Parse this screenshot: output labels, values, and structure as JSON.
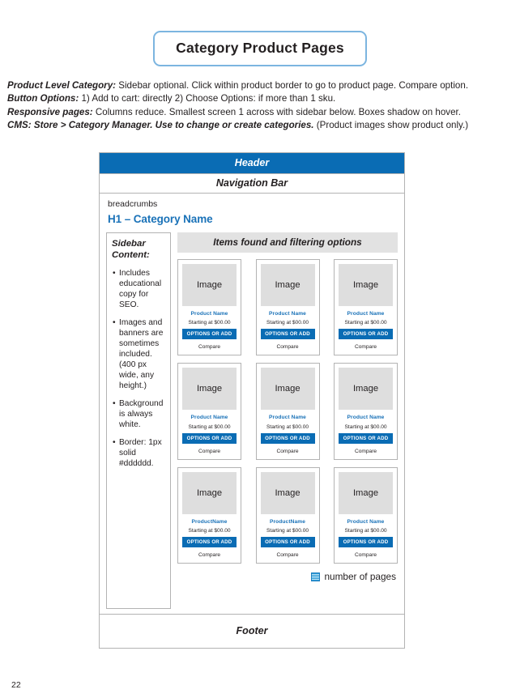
{
  "title": "Category Product Pages",
  "notes": [
    {
      "lead": "Product Level Category:",
      "rest": " Sidebar optional. Click within product border to go to product page. Compare option."
    },
    {
      "lead": "Button Options:",
      "rest": " 1) Add to cart: directly 2) Choose Options: if more than 1 sku."
    },
    {
      "lead": "Responsive pages:",
      "rest": " Columns reduce. Smallest screen 1 across with sidebar below. Boxes shadow on hover."
    },
    {
      "lead": "CMS: Store > Category Manager. Use to change or create categories.",
      "rest": " (Product images show product only.)"
    }
  ],
  "wireframe": {
    "header": "Header",
    "nav": "Navigation Bar",
    "breadcrumbs": "breadcrumbs",
    "h1": "H1 – Category Name",
    "filter_bar": "Items found and filtering options",
    "footer": "Footer",
    "pager": {
      "icon": "image-placeholder-icon",
      "label": "number of pages"
    },
    "sidebar": {
      "title": "Sidebar Content:",
      "items": [
        "Includes educational copy for SEO.",
        "Images and banners are sometimes included. (400 px wide, any height.)",
        "Background is always white.",
        "Border: 1px solid #dddddd."
      ]
    },
    "card_defaults": {
      "image": "Image",
      "price": "Starting at $00.00",
      "button": "OPTIONS OR ADD",
      "compare": "Compare"
    },
    "rows": [
      {
        "cards": [
          {
            "image": "Image",
            "name": "Product Name",
            "price": "Starting at $00.00",
            "button": "OPTIONS OR ADD",
            "compare": "Compare"
          },
          {
            "image": "Image",
            "name": "Product Name",
            "price": "Starting at $00.00",
            "button": "OPTIONS OR ADD",
            "compare": "Compare"
          },
          {
            "image": "Image",
            "name": "Product Name",
            "price": "Starting at $00.00",
            "button": "OPTIONS OR ADD",
            "compare": "Compare"
          }
        ]
      },
      {
        "cards": [
          {
            "image": "Image",
            "name": "Product Name",
            "price": "Starting at $00.00",
            "button": "OPTIONS OR ADD",
            "compare": "Compare"
          },
          {
            "image": "Image",
            "name": "Product Name",
            "price": "Starting at $00.00",
            "button": "OPTIONS OR ADD",
            "compare": "Compare"
          },
          {
            "image": "Image",
            "name": "Product Name",
            "price": "Starting at $00.00",
            "button": "OPTIONS OR ADD",
            "compare": "Compare"
          }
        ]
      },
      {
        "cards": [
          {
            "image": "Image",
            "name": "ProductName",
            "price": "Starting at $00.00",
            "button": "OPTIONS OR ADD",
            "compare": "Compare"
          },
          {
            "image": "Image",
            "name": "ProductName",
            "price": "Starting at $00.00",
            "button": "OPTIONS OR ADD",
            "compare": "Compare"
          },
          {
            "image": "Image",
            "name": "Product Name",
            "price": "Starting at $00.00",
            "button": "OPTIONS OR ADD",
            "compare": "Compare"
          }
        ]
      }
    ]
  },
  "page_number": "22",
  "colors": {
    "brand_blue": "#0a6cb4",
    "link_blue": "#1a72b8",
    "title_border": "#7cb5e0",
    "filter_gray": "#e2e2e2",
    "image_gray": "#dedede",
    "wire_border": "#b3b3b3"
  }
}
